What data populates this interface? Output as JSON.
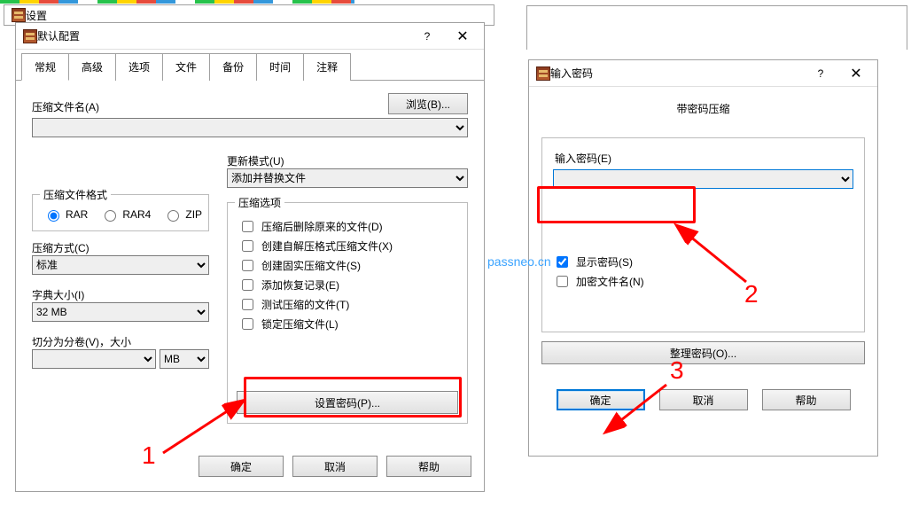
{
  "behind_settings_title": "设置",
  "default_config": {
    "title": "默认配置",
    "tabs": [
      "常规",
      "高级",
      "选项",
      "文件",
      "备份",
      "时间",
      "注释"
    ],
    "archive_name_label": "压缩文件名(A)",
    "browse_btn": "浏览(B)...",
    "update_mode_label": "更新模式(U)",
    "update_mode_value": "添加并替换文件",
    "format_legend": "压缩文件格式",
    "formats": [
      "RAR",
      "RAR4",
      "ZIP"
    ],
    "method_label": "压缩方式(C)",
    "method_value": "标准",
    "dict_label": "字典大小(I)",
    "dict_value": "32 MB",
    "split_label": "切分为分卷(V)，大小",
    "split_unit": "MB",
    "options_legend": "压缩选项",
    "options": [
      "压缩后删除原来的文件(D)",
      "创建自解压格式压缩文件(X)",
      "创建固实压缩文件(S)",
      "添加恢复记录(E)",
      "测试压缩的文件(T)",
      "锁定压缩文件(L)"
    ],
    "set_password_btn": "设置密码(P)...",
    "ok": "确定",
    "cancel": "取消",
    "help": "帮助"
  },
  "password_dialog": {
    "title": "输入密码",
    "header": "带密码压缩",
    "enter_label": "输入密码(E)",
    "show_password": "显示密码(S)",
    "encrypt_names": "加密文件名(N)",
    "organize_btn": "整理密码(O)...",
    "ok": "确定",
    "cancel": "取消",
    "help": "帮助"
  },
  "watermark": "passneo.cn",
  "annotations": {
    "n1": "1",
    "n2": "2",
    "n3": "3"
  }
}
